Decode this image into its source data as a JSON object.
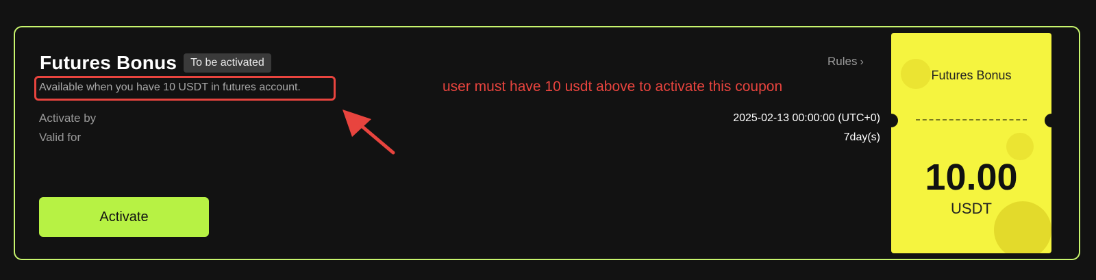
{
  "card": {
    "title": "Futures Bonus",
    "status_badge": "To be activated",
    "rules_label": "Rules",
    "condition": "Available when you have 10 USDT in futures account.",
    "annotation": "user must have 10 usdt above to activate this coupon",
    "activate_by_label": "Activate by",
    "activate_by_value": "2025-02-13 00:00:00 (UTC+0)",
    "valid_for_label": "Valid for",
    "valid_for_value": "7day(s)",
    "activate_button": "Activate"
  },
  "coupon": {
    "title": "Futures Bonus",
    "amount": "10.00",
    "unit": "USDT"
  },
  "colors": {
    "background": "#121212",
    "card_border": "#c8f56e",
    "button": "#b7f244",
    "coupon": "#f5f43f",
    "annotation": "#e8443e"
  },
  "icons": {
    "rules_chevron": "chevron-right-icon",
    "annotation_arrow": "arrow-icon"
  }
}
